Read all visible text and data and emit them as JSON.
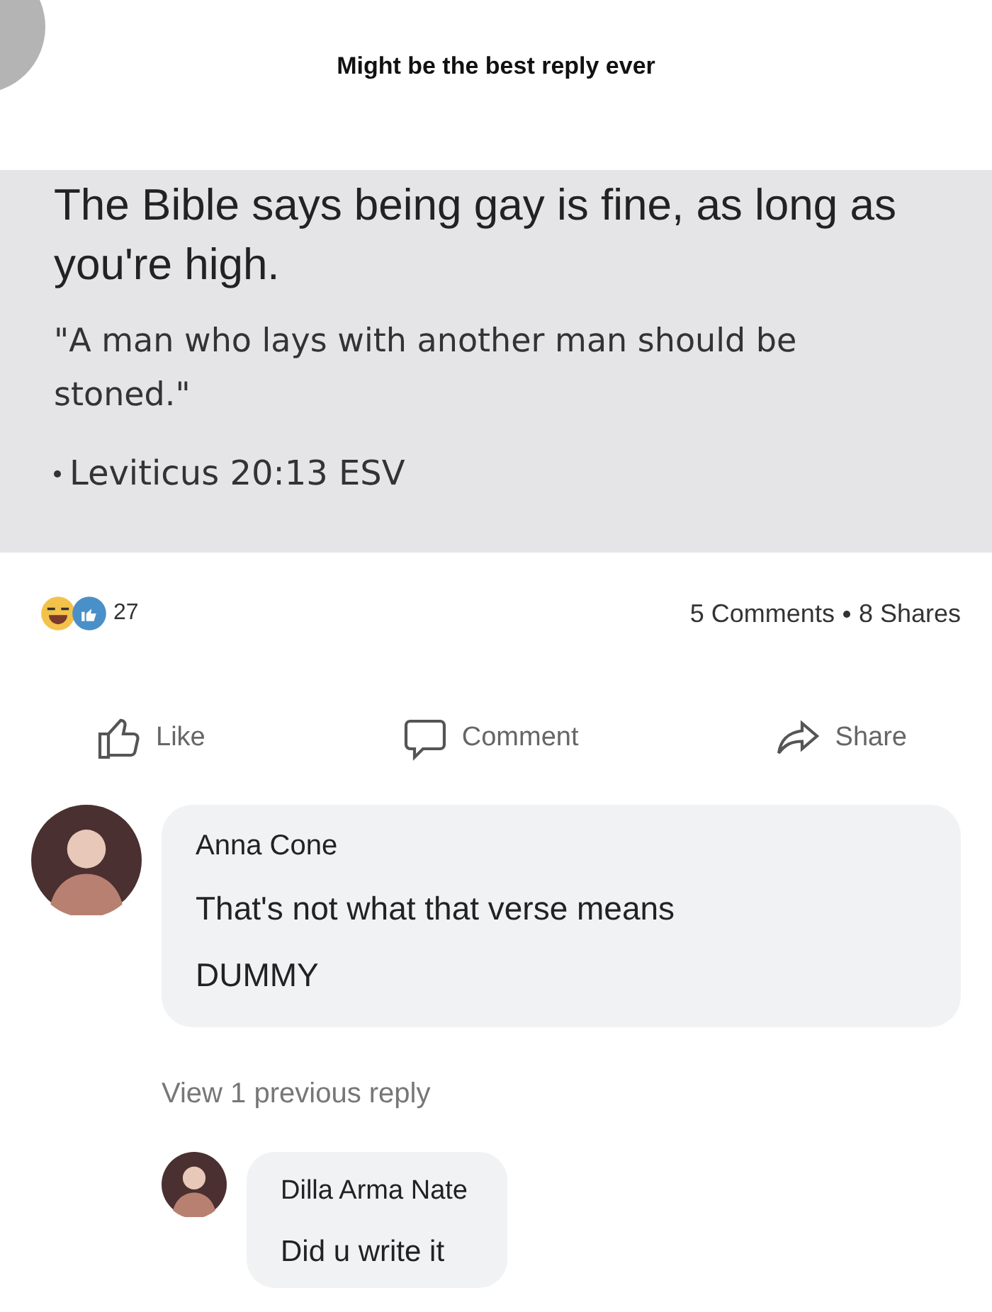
{
  "caption": "Might be the best reply ever",
  "post": {
    "headline": "The Bible says being gay is fine, as long as you're high.",
    "quote": "\"A man who lays with another man should be stoned.\"",
    "reference": "Leviticus 20:13 ESV"
  },
  "stats": {
    "reaction_count": "27",
    "comments": "5 Comments",
    "shares": "8 Shares"
  },
  "actions": [
    {
      "kind": "like",
      "label": "Like"
    },
    {
      "kind": "comment",
      "label": "Comment"
    },
    {
      "kind": "share",
      "label": "Share"
    }
  ],
  "comment": {
    "author": "Anna Cone",
    "lines": [
      "That's not what that verse means",
      "DUMMY"
    ]
  },
  "view_replies": "View 1 previous reply",
  "reply": {
    "author": "Dilla Arma Nate",
    "text": "Did u write it"
  }
}
